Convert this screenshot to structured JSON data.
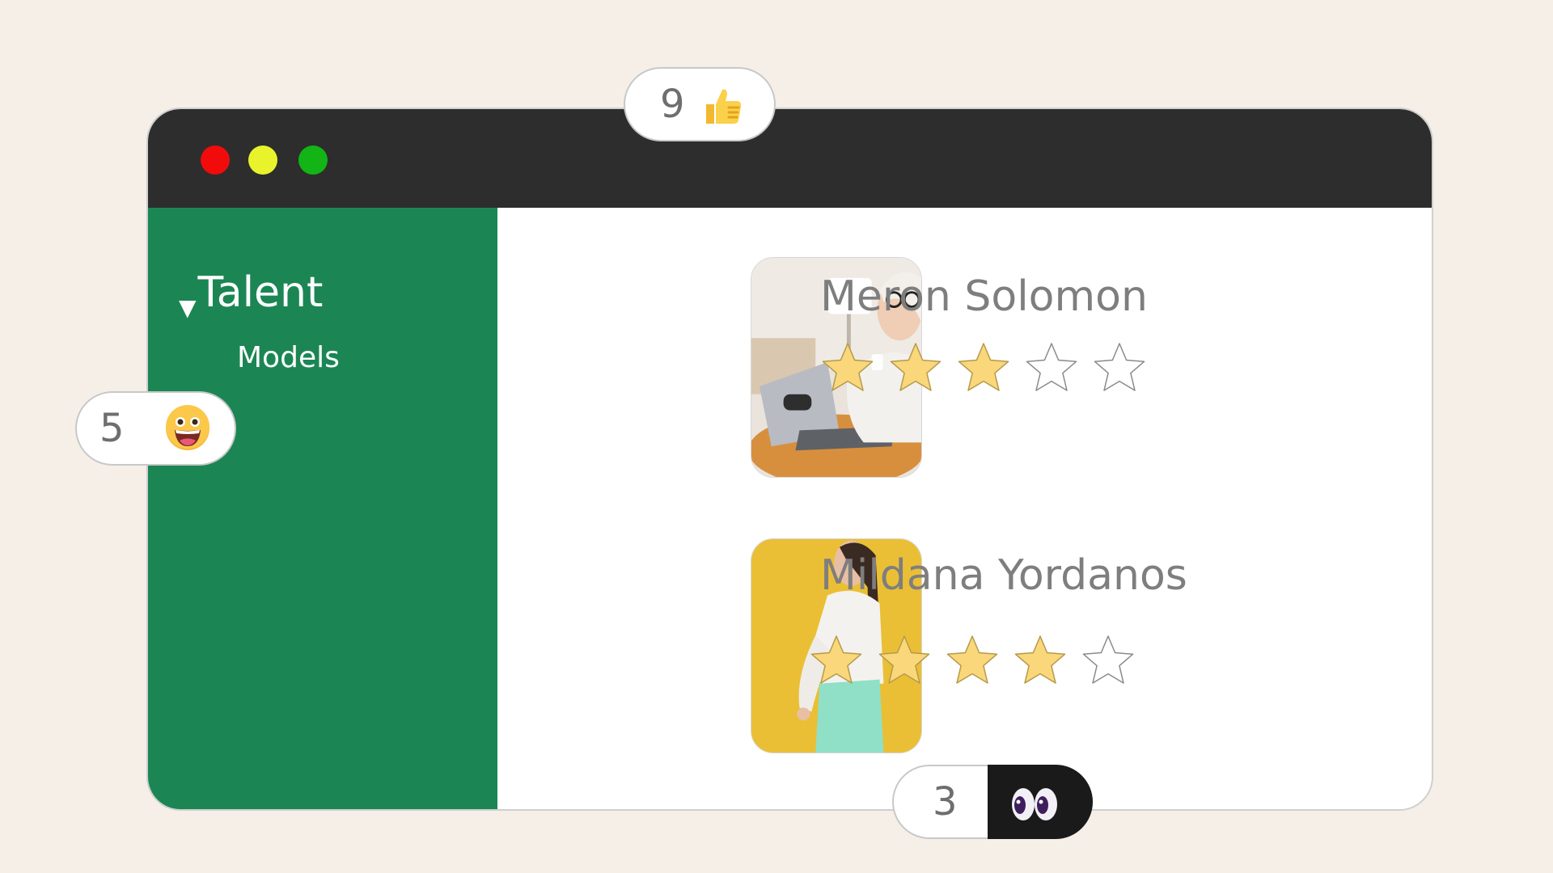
{
  "window": {
    "controls": [
      {
        "name": "close",
        "color": "#f10b0b"
      },
      {
        "name": "minimize",
        "color": "#e8f32b"
      },
      {
        "name": "maximize",
        "color": "#13b416"
      }
    ]
  },
  "sidebar": {
    "group_label": "Talent",
    "group_icon": "triangle-down-icon",
    "items": [
      {
        "label": "Models"
      }
    ]
  },
  "talent": [
    {
      "name": "Meron Solomon",
      "rating": 3,
      "max_rating": 5,
      "photo": "woman-with-laptop-photo"
    },
    {
      "name": "Mildana Yordanos",
      "rating": 4,
      "max_rating": 5,
      "photo": "woman-on-yellow-background-photo"
    }
  ],
  "reactions": [
    {
      "count": "9",
      "icon": "thumbs-up-icon"
    },
    {
      "count": "5",
      "icon": "grinning-face-icon"
    },
    {
      "count": "3",
      "icon": "eyes-icon"
    }
  ],
  "colors": {
    "background": "#f5efe8",
    "titlebar": "#2d2d2d",
    "sidebar": "#1b8654",
    "star_filled": "#f9d77a",
    "star_empty": "#ffffff"
  }
}
